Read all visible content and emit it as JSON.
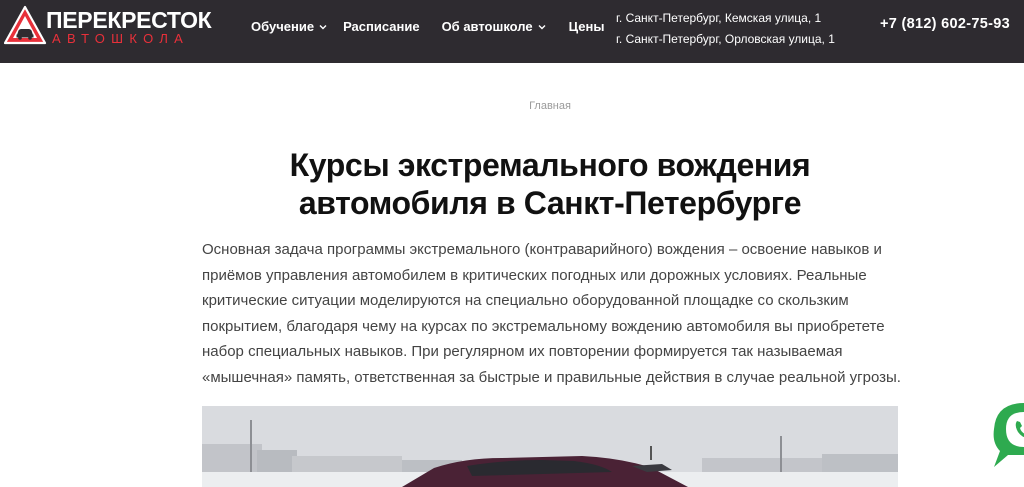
{
  "header": {
    "logo": {
      "title": "ПЕРЕКРЕСТОК",
      "subtitle": "АВТОШКОЛА"
    },
    "nav": [
      {
        "label": "Обучение",
        "has_dropdown": true
      },
      {
        "label": "Расписание",
        "has_dropdown": false
      },
      {
        "label": "Об автошколе",
        "has_dropdown": true
      },
      {
        "label": "Цены",
        "has_dropdown": false
      }
    ],
    "addresses": [
      "г. Санкт-Петербург, Кемская улица, 1",
      "г. Санкт-Петербург, Орловская улица, 1"
    ],
    "phone": "+7 (812) 602-75-93"
  },
  "breadcrumb": {
    "home": "Главная"
  },
  "main": {
    "title": "Курсы экстремального вождения автомобиля в Санкт-Петербурге",
    "intro": "Основная задача программы экстремального (контраварийного) вождения – освоение навыков и приёмов управления автомобилем в критических погодных или дорожных условиях. Реальные критические ситуации моделируются на специально оборудованной площадке со скользким покрытием, благодаря чему на курсах по экстремальному вождению автомобиля вы приобретете набор специальных навыков. При регулярном их повторении формируется так называемая «мышечная» память, ответственная за быстрые и правильные действия в случае реальной угрозы."
  },
  "colors": {
    "header_bg": "#2e2b30",
    "logo_accent": "#e8303a",
    "chat_green": "#2eaa4f",
    "text": "#444444",
    "title": "#111111"
  },
  "icons": {
    "logo": "warning-triangle-car-icon",
    "dropdown": "chevron-down-icon",
    "chat": "chat-bubble-icon"
  }
}
